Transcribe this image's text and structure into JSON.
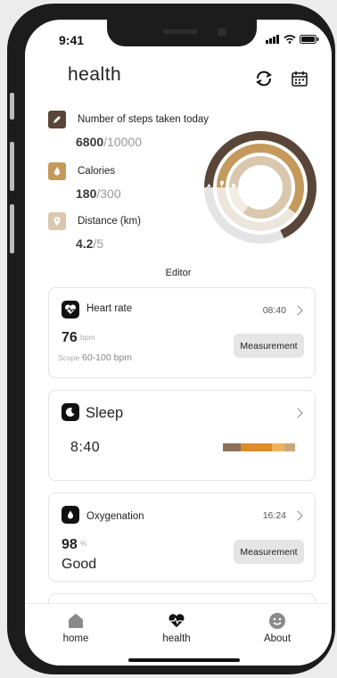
{
  "status": {
    "time": "9:41"
  },
  "header": {
    "title": "health",
    "refresh_icon": "refresh-icon",
    "calendar_icon": "calendar-icon"
  },
  "stats": {
    "steps": {
      "label": "Number of steps taken today",
      "current": "6800",
      "total": "/10000",
      "progress": 0.68,
      "color": "#5a4638"
    },
    "calories": {
      "label": "Calories",
      "current": "180",
      "total": "/300",
      "progress": 0.6,
      "color": "#c49a5c"
    },
    "distance": {
      "label": "Distance (km)",
      "current": "4.2",
      "total": "/5",
      "progress": 0.84,
      "color": "#d9c7ae"
    }
  },
  "editor_label": "Editor",
  "heart": {
    "title": "Heart rate",
    "time": "08:40",
    "value": "76",
    "unit": "bpm",
    "scope_label": "Scope",
    "scope_value": "60-100 bpm",
    "button": "Measurement"
  },
  "sleep": {
    "title": "Sleep",
    "value": "8:40",
    "colors": [
      "#8b7158",
      "#e08a2c",
      "#f0b35a",
      "#c9a77c"
    ]
  },
  "oxygen": {
    "title": "Oxygenation",
    "time": "16:24",
    "value": "98",
    "unit": "%",
    "status": "Good",
    "button": "Measurement"
  },
  "tabs": [
    {
      "label": "home",
      "icon": "home-icon"
    },
    {
      "label": "health",
      "icon": "heart-icon"
    },
    {
      "label": "About",
      "icon": "smile-icon"
    }
  ]
}
